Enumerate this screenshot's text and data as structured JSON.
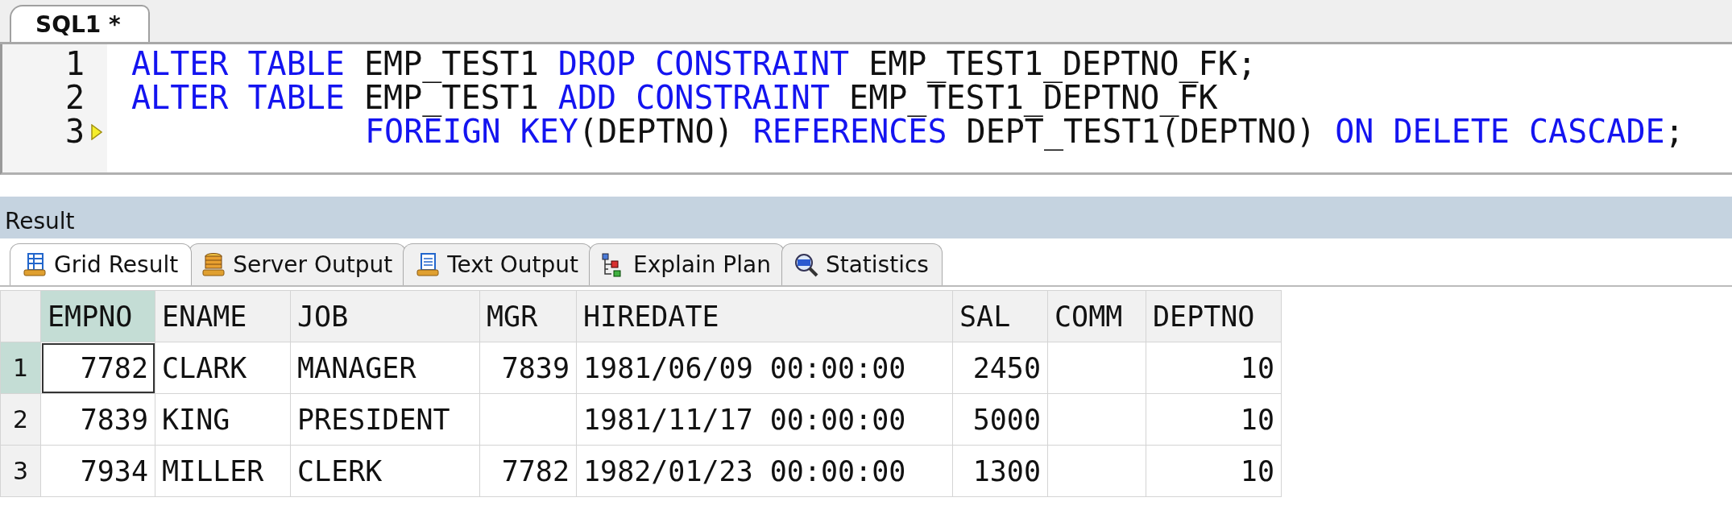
{
  "editor_tabs": [
    {
      "label": "SQL1 *",
      "selected": true
    }
  ],
  "editor": {
    "lines": [
      {
        "number": "1",
        "current": false,
        "continuation": false,
        "tokens": [
          {
            "text": "ALTER TABLE",
            "kind": "keyword"
          },
          {
            "text": "EMP_TEST1",
            "kind": "ident"
          },
          {
            "text": "DROP CONSTRAINT",
            "kind": "keyword"
          },
          {
            "text": "EMP_TEST1_DEPTNO_FK;",
            "kind": "ident"
          }
        ]
      },
      {
        "number": "2",
        "current": false,
        "continuation": false,
        "tokens": [
          {
            "text": "ALTER TABLE",
            "kind": "keyword"
          },
          {
            "text": "EMP_TEST1",
            "kind": "ident"
          },
          {
            "text": "ADD CONSTRAINT",
            "kind": "keyword"
          },
          {
            "text": "EMP_TEST1_DEPTNO_FK",
            "kind": "ident"
          }
        ]
      },
      {
        "number": "3",
        "current": true,
        "continuation": true,
        "tokens": [
          {
            "text": "FOREIGN KEY",
            "kind": "keyword"
          },
          {
            "text": "(DEPTNO)",
            "kind": "ident",
            "joined": true
          },
          {
            "text": "REFERENCES",
            "kind": "keyword"
          },
          {
            "text": "DEPT_TEST1(DEPTNO)",
            "kind": "ident"
          },
          {
            "text": "ON DELETE CASCADE",
            "kind": "keyword"
          },
          {
            "text": ";",
            "kind": "ident",
            "joined": true
          }
        ]
      }
    ]
  },
  "result": {
    "title": "Result",
    "tabs": [
      {
        "label": "Grid Result",
        "kind": "grid",
        "selected": true
      },
      {
        "label": "Server Output",
        "kind": "server",
        "selected": false
      },
      {
        "label": "Text Output",
        "kind": "text",
        "selected": false
      },
      {
        "label": "Explain Plan",
        "kind": "plan",
        "selected": false
      },
      {
        "label": "Statistics",
        "kind": "stats",
        "selected": false
      }
    ],
    "table": {
      "columns": [
        {
          "label": "EMPNO",
          "kind": "number",
          "selected": true
        },
        {
          "label": "ENAME",
          "kind": "text",
          "selected": false
        },
        {
          "label": "JOB",
          "kind": "text",
          "selected": false
        },
        {
          "label": "MGR",
          "kind": "number",
          "selected": false
        },
        {
          "label": "HIREDATE",
          "kind": "text",
          "selected": false
        },
        {
          "label": "SAL",
          "kind": "number",
          "selected": false
        },
        {
          "label": "COMM",
          "kind": "number",
          "selected": false
        },
        {
          "label": "DEPTNO",
          "kind": "number",
          "selected": false
        }
      ],
      "rows": [
        {
          "number": "1",
          "selected": true,
          "cells": [
            "7782",
            "CLARK",
            "MANAGER",
            "7839",
            "1981/06/09 00:00:00",
            "2450",
            "",
            "10"
          ]
        },
        {
          "number": "2",
          "selected": false,
          "cells": [
            "7839",
            "KING",
            "PRESIDENT",
            "",
            "1981/11/17 00:00:00",
            "5000",
            "",
            "10"
          ]
        },
        {
          "number": "3",
          "selected": false,
          "cells": [
            "7934",
            "MILLER",
            "CLERK",
            "7782",
            "1982/01/23 00:00:00",
            "1300",
            "",
            "10"
          ]
        }
      ]
    }
  }
}
